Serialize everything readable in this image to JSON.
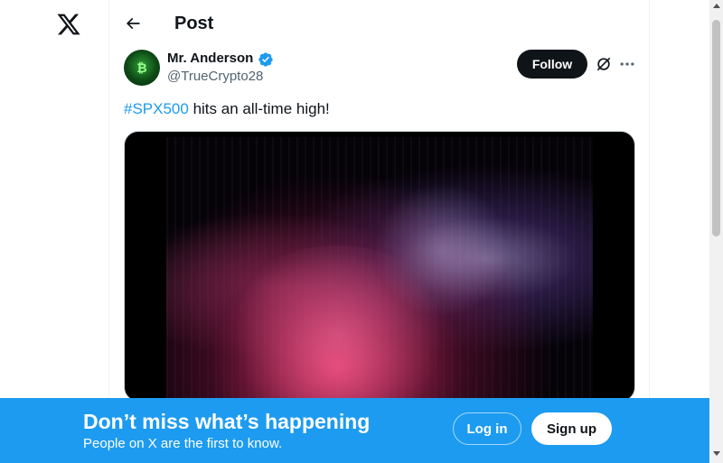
{
  "header": {
    "title": "Post"
  },
  "post": {
    "author_name": "Mr. Anderson",
    "author_handle": "@TrueCrypto28",
    "follow_label": "Follow",
    "hashtag": "#SPX500",
    "text_rest": " hits an all-time high!"
  },
  "banner": {
    "title": "Don’t miss what’s happening",
    "subtitle": "People on X are the first to know.",
    "login_label": "Log in",
    "signup_label": "Sign up"
  },
  "icons": {
    "logo": "x-logo-icon",
    "back": "arrow-left-icon",
    "verified": "verified-badge-icon",
    "grok": "grok-icon",
    "more": "more-horizontal-icon"
  },
  "colors": {
    "accent": "#1d9bf0",
    "text": "#0f1419",
    "muted": "#536471",
    "follow_bg": "#0f1419"
  }
}
